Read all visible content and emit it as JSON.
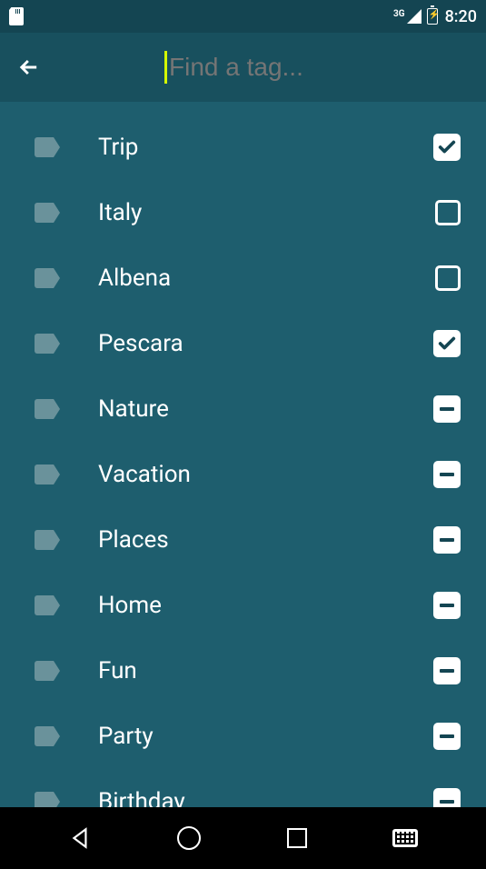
{
  "status": {
    "network": "3G",
    "time": "8:20"
  },
  "search": {
    "placeholder": "Find a tag..."
  },
  "tags": [
    {
      "label": "Trip",
      "state": "checked"
    },
    {
      "label": "Italy",
      "state": "empty"
    },
    {
      "label": "Albena",
      "state": "empty"
    },
    {
      "label": "Pescara",
      "state": "checked"
    },
    {
      "label": "Nature",
      "state": "partial"
    },
    {
      "label": "Vacation",
      "state": "partial"
    },
    {
      "label": "Places",
      "state": "partial"
    },
    {
      "label": "Home",
      "state": "partial"
    },
    {
      "label": "Fun",
      "state": "partial"
    },
    {
      "label": "Party",
      "state": "partial"
    },
    {
      "label": "Birthday",
      "state": "partial"
    }
  ]
}
